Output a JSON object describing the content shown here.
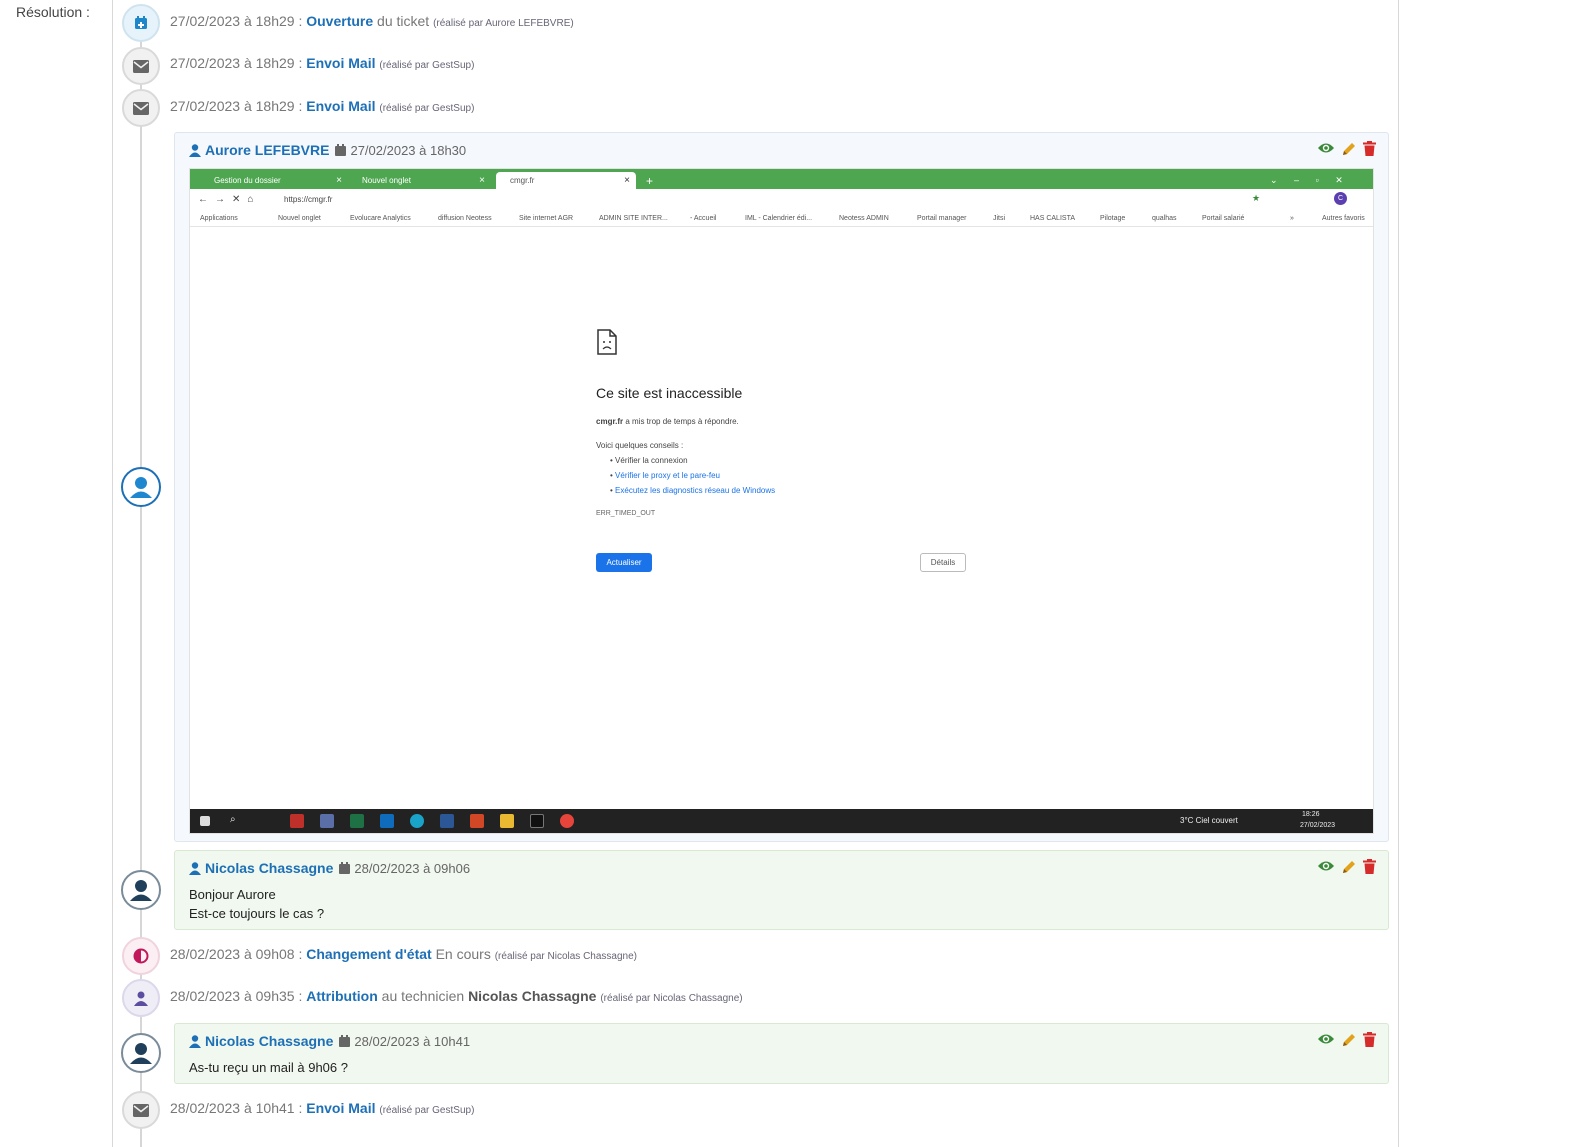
{
  "colors": {
    "link": "#1d6fb6",
    "eye": "#3a8a3a",
    "pencil": "#e2a21b",
    "trash": "#d62b2b",
    "chrome_green": "#4ea650",
    "button_blue": "#1a73e8"
  },
  "resolution_label": "Résolution :",
  "events": [
    {
      "date": "27/02/2023 à 18h29 :",
      "action": "Ouverture",
      "rest": " du ticket",
      "by": "(réalisé par Aurore LEFEBVRE)",
      "icon": "calendar-plus-icon"
    },
    {
      "date": "27/02/2023 à 18h29 :",
      "action": "Envoi Mail",
      "rest": "",
      "by": "(réalisé par GestSup)",
      "icon": "envelope-icon"
    },
    {
      "date": "27/02/2023 à 18h29 :",
      "action": "Envoi Mail",
      "rest": "",
      "by": "(réalisé par GestSup)",
      "icon": "envelope-icon"
    },
    {
      "date": "28/02/2023 à 09h08 :",
      "action": "Changement d'état",
      "rest": " En cours",
      "by": "(réalisé par Nicolas Chassagne)",
      "icon": "half-circle-icon"
    },
    {
      "date": "28/02/2023 à 09h35 :",
      "action": "Attribution",
      "rest": " au technicien ",
      "strong": "Nicolas Chassagne",
      "by": "(réalisé par Nicolas Chassagne)",
      "icon": "user-icon"
    },
    {
      "date": "28/02/2023 à 10h41 :",
      "action": "Envoi Mail",
      "rest": "",
      "by": "(réalisé par GestSup)",
      "icon": "envelope-icon"
    }
  ],
  "comments": [
    {
      "author": "Aurore LEFEBVRE",
      "date": "27/02/2023 à 18h30"
    },
    {
      "author": "Nicolas Chassagne",
      "date": "28/02/2023 à 09h06",
      "lines": [
        "Bonjour Aurore",
        "Est-ce toujours le cas ?"
      ]
    },
    {
      "author": "Nicolas Chassagne",
      "date": "28/02/2023 à 10h41",
      "lines": [
        "As-tu reçu un mail à 9h06 ?"
      ]
    }
  ],
  "screenshot": {
    "tabs": [
      "Gestion du dossier",
      "Nouvel onglet",
      "cmgr.fr"
    ],
    "url": "https://cmgr.fr",
    "bookmarks": [
      "Applications",
      "Nouvel onglet",
      "Evolucare Analytics",
      "diffusion Neotess",
      "Site internet AGR",
      "ADMIN SITE INTER...",
      "- Accueil",
      "IML - Calendrier édi...",
      "Neotess ADMIN",
      "Portail manager",
      "Jitsi",
      "HAS CALISTA",
      "Pilotage",
      "qualhas",
      "Portail salarié",
      "»",
      "Autres favoris"
    ],
    "error": {
      "title": "Ce site est inaccessible",
      "host": "cmgr.fr",
      "message": " a mis trop de temps à répondre.",
      "tips_title": "Voici quelques conseils :",
      "tips": [
        "Vérifier la connexion",
        "Vérifier le proxy et le pare-feu",
        "Exécutez les diagnostics réseau de Windows"
      ],
      "code": "ERR_TIMED_OUT",
      "refresh": "Actualiser",
      "details": "Détails"
    },
    "taskbar": {
      "weather": "3°C  Ciel couvert",
      "time": "18:26",
      "date": "27/02/2023"
    }
  }
}
